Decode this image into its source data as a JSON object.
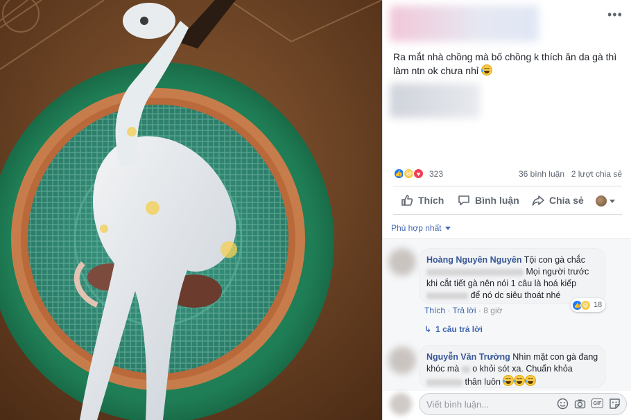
{
  "post": {
    "text": "Ra mắt nhà chồng mà bố chồng k thích ăn da gà thì làm ntn ok chưa nhỉ",
    "more_icon": "more-horizontal-icon"
  },
  "stats": {
    "reaction_icons": [
      "like-icon",
      "haha-icon",
      "love-icon"
    ],
    "reaction_count": "323",
    "comments": "36 bình luận",
    "shares": "2 lượt chia sẻ"
  },
  "actions": {
    "like": "Thích",
    "comment": "Bình luận",
    "share": "Chia sẻ"
  },
  "sort": {
    "label": "Phù hợp nhất"
  },
  "comments": [
    {
      "author": "Hoàng Nguyên Nguyên",
      "text_1": "Tội con gà chắc",
      "text_2": "Mọi người trước khi cắt tiết gà nên nói 1 câu là hoá kiếp",
      "text_3": "để nó dc siêu thoát nhé",
      "like_link": "Thích",
      "reply_link": "Trả lời",
      "separator": "·",
      "time": "8 giờ",
      "reaction_count": "18",
      "replies": "1 câu trả lời"
    },
    {
      "author": "Nguyễn Văn Trường",
      "text_1": "Nhìn mặt con gà đang khóc mà",
      "text_2": "o khỏi sót xa. Chuẩn khỏa",
      "text_3": "thân luôn"
    }
  ],
  "composer": {
    "placeholder": "Viết bình luận..."
  },
  "colors": {
    "link": "#385898",
    "accent": "#4267b2",
    "like_blue": "#2078f4",
    "love_red": "#f33e58",
    "haha_yellow": "#f7c948"
  }
}
